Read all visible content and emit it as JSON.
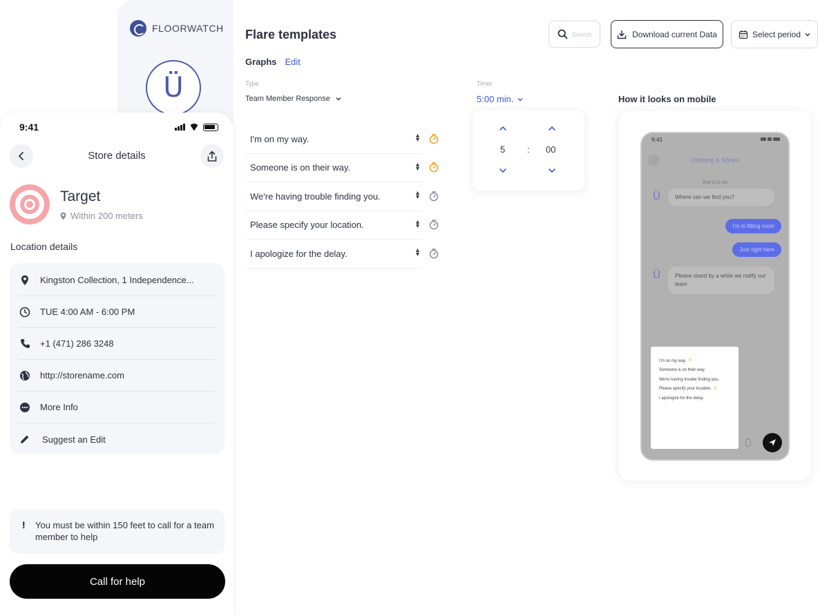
{
  "brand": {
    "name": "FLOORWATCH"
  },
  "phone": {
    "status_time": "9:41",
    "nav_title": "Store details",
    "store": {
      "name": "Target",
      "distance": "Within 200 meters"
    },
    "section_title": "Location details",
    "details": [
      {
        "icon": "location-pin-icon",
        "text": "Kingston Collection, 1 Independence..."
      },
      {
        "icon": "clock-icon",
        "text": "TUE 4:00 AM - 6:00 PM"
      },
      {
        "icon": "phone-icon",
        "text": "+1 (471) 286 3248"
      },
      {
        "icon": "globe-icon",
        "text": "http://storename.com"
      },
      {
        "icon": "more-icon",
        "text": "More Info"
      },
      {
        "icon": "pencil-icon",
        "text": "Suggest an Edit"
      }
    ],
    "notice": {
      "mark": "!",
      "text": "You must be within 150 feet to call for a team member to help"
    },
    "call_button": "Call for help"
  },
  "main": {
    "title": "Flare templates",
    "search_placeholder": "Search",
    "download_button": "Download current Data",
    "period_button": "Select period",
    "tabs": {
      "graphs": "Graphs",
      "edit": "Edit"
    },
    "type": {
      "label": "Type",
      "value": "Team Member Response"
    },
    "timer": {
      "label": "Timer",
      "value": "5:00 min."
    },
    "templates": [
      {
        "text": "I'm on my way.",
        "timer_on": true
      },
      {
        "text": "Someone is on their way.",
        "timer_on": true
      },
      {
        "text": "We're having trouble finding you.",
        "timer_on": false
      },
      {
        "text": "Please specify your location.",
        "timer_on": false
      },
      {
        "text": "I apologize for the delay.",
        "timer_on": false
      }
    ],
    "time_picker": {
      "minutes": "5",
      "separator": ":",
      "seconds": "00"
    },
    "mobile_preview": {
      "title": "How it looks on mobile",
      "status_time": "9:41",
      "chat_title": "Clothing & Shoes",
      "date": "Wed 8:21 AM",
      "messages": [
        {
          "from": "agent",
          "text": "Where can we find you?"
        },
        {
          "from": "user",
          "text": "I'm in fitting room"
        },
        {
          "from": "user",
          "text": "Just right here"
        },
        {
          "from": "agent",
          "text": "Please stand by a while we notify our team"
        }
      ],
      "popup": [
        "I'm on my way.",
        "Someone is on their way.",
        "We're having trouble finding you.",
        "Please specify your location.",
        "I apologize for the delay."
      ]
    }
  },
  "colors": {
    "accent": "#3d5ad6",
    "timer_active": "#f0a629",
    "timer_inactive": "#8c93a1",
    "target_red": "#f6a5a9"
  }
}
